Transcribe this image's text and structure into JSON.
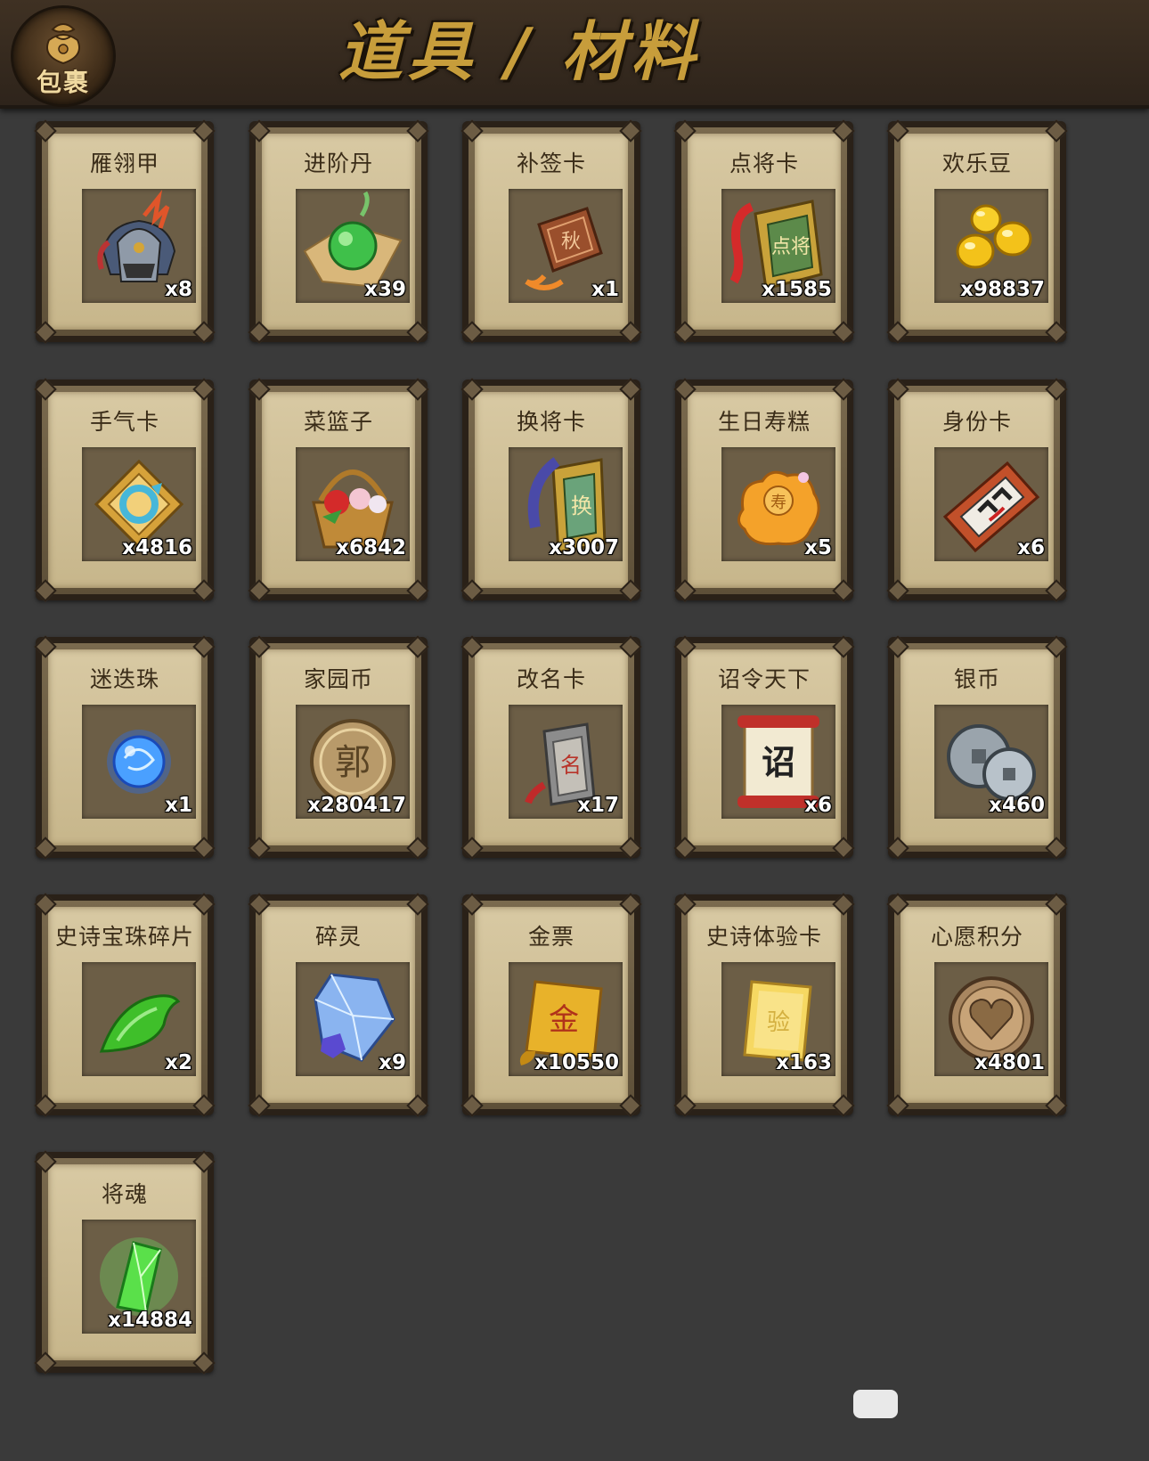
{
  "header": {
    "bag_label": "包裹",
    "title": "道具 / 材料"
  },
  "items": [
    {
      "name": "雁翎甲",
      "qty": "x8",
      "icon": "helmet-armor-icon"
    },
    {
      "name": "进阶丹",
      "qty": "x39",
      "icon": "green-pill-icon"
    },
    {
      "name": "补签卡",
      "qty": "x1",
      "icon": "sign-tablet-icon"
    },
    {
      "name": "点将卡",
      "qty": "x1585",
      "icon": "general-pick-card-icon"
    },
    {
      "name": "欢乐豆",
      "qty": "x98837",
      "icon": "gold-beans-icon"
    },
    {
      "name": "手气卡",
      "qty": "x4816",
      "icon": "luck-card-icon"
    },
    {
      "name": "菜篮子",
      "qty": "x6842",
      "icon": "flower-basket-icon"
    },
    {
      "name": "换将卡",
      "qty": "x3007",
      "icon": "swap-general-card-icon"
    },
    {
      "name": "生日寿糕",
      "qty": "x5",
      "icon": "birthday-cake-icon"
    },
    {
      "name": "身份卡",
      "qty": "x6",
      "icon": "opera-mask-card-icon"
    },
    {
      "name": "迷迭珠",
      "qty": "x1",
      "icon": "blue-orb-icon"
    },
    {
      "name": "家园币",
      "qty": "x280417",
      "icon": "home-coin-icon"
    },
    {
      "name": "改名卡",
      "qty": "x17",
      "icon": "rename-tablet-icon"
    },
    {
      "name": "诏令天下",
      "qty": "x6",
      "icon": "edict-scroll-icon"
    },
    {
      "name": "银币",
      "qty": "x460",
      "icon": "silver-coins-icon"
    },
    {
      "name": "史诗宝珠碎片",
      "qty": "x2",
      "icon": "green-shard-icon"
    },
    {
      "name": "碎灵",
      "qty": "x9",
      "icon": "crystal-puzzle-icon"
    },
    {
      "name": "金票",
      "qty": "x10550",
      "icon": "gold-ticket-icon"
    },
    {
      "name": "史诗体验卡",
      "qty": "x163",
      "icon": "gold-card-icon"
    },
    {
      "name": "心愿积分",
      "qty": "x4801",
      "icon": "heart-coin-icon"
    },
    {
      "name": "将魂",
      "qty": "x14884",
      "icon": "green-soul-crystal-icon"
    }
  ]
}
